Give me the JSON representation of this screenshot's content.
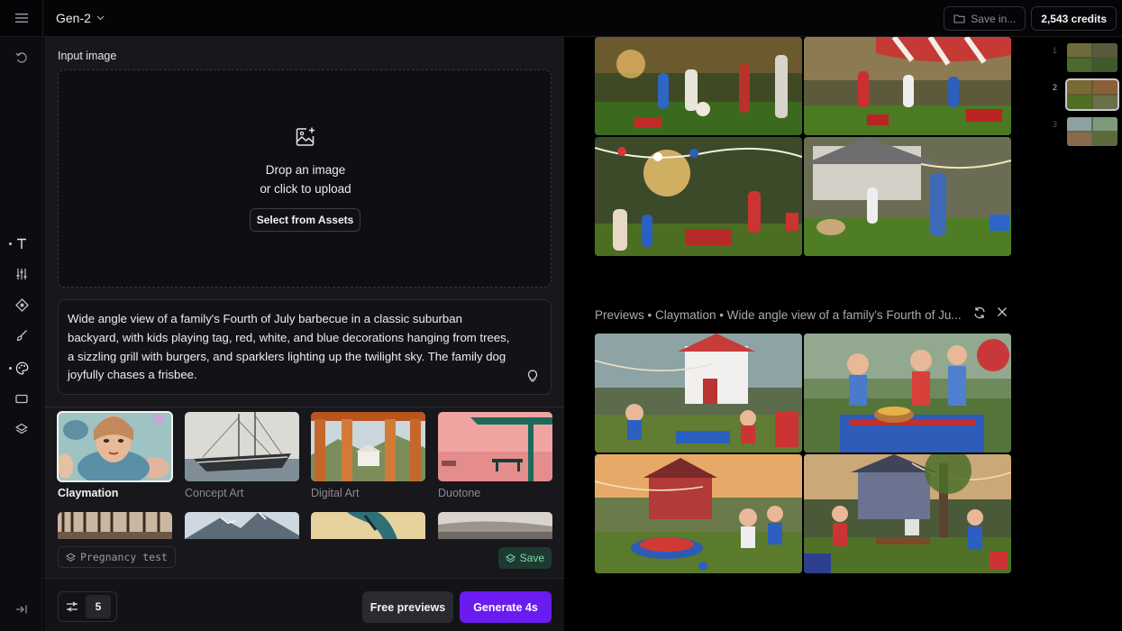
{
  "header": {
    "model": "Gen-2",
    "save_in": "Save in...",
    "credits": "2,543 credits"
  },
  "rail": {
    "items": [
      "undo-icon",
      "text-tool-icon",
      "adjust-sliders-icon",
      "camera-motion-icon",
      "brush-icon",
      "palette-icon",
      "aspect-ratio-icon",
      "layers-icon",
      "collapse-panel-icon"
    ]
  },
  "input": {
    "label": "Input image",
    "drop_line1": "Drop an image",
    "drop_line2": "or click to upload",
    "assets_button": "Select from Assets"
  },
  "prompt": {
    "text": "Wide angle view of a family's Fourth of July barbecue in a classic suburban backyard, with kids playing tag, red, white, and blue decorations hanging from trees, a sizzling grill with burgers, and sparklers lighting up the twilight sky. The family dog joyfully chases a frisbee."
  },
  "styles": {
    "items": [
      {
        "name": "Claymation",
        "selected": true
      },
      {
        "name": "Concept Art",
        "selected": false
      },
      {
        "name": "Digital Art",
        "selected": false
      },
      {
        "name": "Duotone",
        "selected": false
      }
    ]
  },
  "preset": {
    "tag": "Pregnancy test",
    "save": "Save"
  },
  "footer": {
    "count": "5",
    "free_previews": "Free previews",
    "generate": "Generate 4s"
  },
  "gallery": {
    "previews_title": "Previews • Claymation • Wide angle view of a family's Fourth of Ju...",
    "thumbnail_numbers": [
      "1",
      "2",
      "3"
    ],
    "active_thumbnail": 2
  },
  "colors": {
    "accent": "#6a1cf0",
    "save_green": "#7ed4ad",
    "panel": "#17171c"
  }
}
